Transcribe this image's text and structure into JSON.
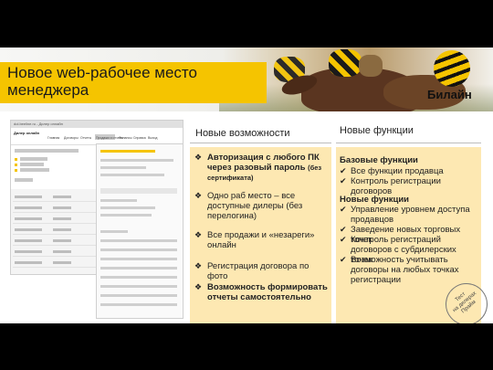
{
  "header": {
    "title_line1": "Новое web-рабочее место",
    "title_line2": "менеджера",
    "brand": "Билайн"
  },
  "screenshot": {
    "window_title": "dol.beeline.ru - Дилер онлайн",
    "app_name": "Дилер онлайн",
    "nav_items": [
      "Главная",
      "Договоры",
      "Отчеты",
      "Продажи и отчеты",
      "Финансы",
      "Справка",
      "Выход"
    ]
  },
  "features": {
    "heading": "Новые возможности",
    "items": [
      {
        "symbol": "❖",
        "text": "Авторизация с любого ПК через разовый пароль",
        "extra": "(без сертификата)",
        "bold": true
      },
      {
        "symbol": "❖",
        "text": "Одно раб место – все доступные дилеры (без перелогина)",
        "extra": "",
        "bold": false
      },
      {
        "symbol": "❖",
        "text": "Все продажи и «незареги» онлайн",
        "extra": "",
        "bold": false
      },
      {
        "symbol": "❖",
        "text": "Регистрация договора по фото",
        "extra": "",
        "bold": false
      },
      {
        "symbol": "❖",
        "text": "Возможность формировать отчеты самостоятельно",
        "extra": "",
        "bold": true
      }
    ]
  },
  "functions": {
    "heading": "Новые функции",
    "basic_title": "Базовые функции",
    "basic_items": [
      "Все функции продавца",
      "Контроль регистрации договоров"
    ],
    "new_title": "Новые функции",
    "new_items": [
      "Управление уровнем доступа продавцов",
      "Заведение новых торговых точек",
      "Контроль регистраций договоров с субдилерских точек",
      "Возможность учитывать договоры на любых точках регистрации"
    ],
    "check_symbol": "✔"
  },
  "stamp": {
    "line1": "Тест",
    "line2": "на дилерах",
    "line3": "Прайм"
  },
  "colors": {
    "accent": "#f5c400",
    "panel": "#fde8b2",
    "text": "#222222"
  }
}
